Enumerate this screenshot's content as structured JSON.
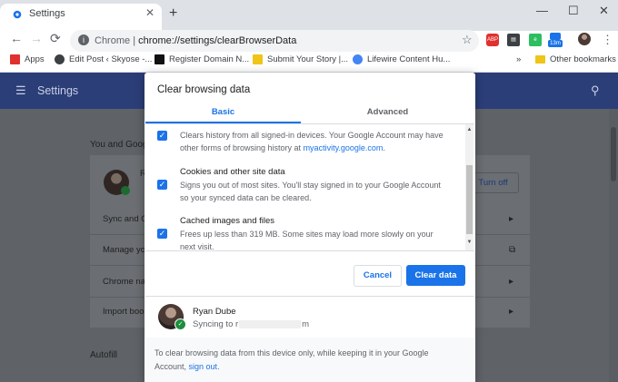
{
  "browser": {
    "tab": {
      "title": "Settings",
      "close": "✕"
    },
    "new_tab": "+",
    "window_controls": {
      "minimize": "—",
      "maximize": "☐",
      "close": "✕"
    },
    "nav": {
      "back": "←",
      "forward": "→",
      "reload": "⟳"
    },
    "omnibox": {
      "host_label": "Chrome",
      "separator": "|",
      "url": "chrome://settings/clearBrowserData",
      "star": "☆"
    },
    "extensions": [
      {
        "name": "abp-extension-icon",
        "color": "#e0302f",
        "text": "ABP"
      },
      {
        "name": "extension-icon-2",
        "color": "#3c4043",
        "text": "▤"
      },
      {
        "name": "evernote-icon",
        "color": "#2dbe60",
        "text": "e"
      },
      {
        "name": "extension-icon-4",
        "color": "#1e8e3e",
        "text": "●"
      },
      {
        "name": "extension-badge-icon",
        "color": "#1a73e8",
        "text": "13m"
      }
    ],
    "menu": "⋮",
    "bookmarks": [
      {
        "label": "Apps",
        "icon": "apps-grid-icon",
        "color": "#e0302f"
      },
      {
        "label": "Edit Post ‹ Skyose -...",
        "icon": "globe-icon",
        "color": "#3c4043"
      },
      {
        "label": "Register Domain N...",
        "icon": "domain-icon",
        "color": "#111111"
      },
      {
        "label": "Submit Your Story |...",
        "icon": "story-icon",
        "color": "#f0c419"
      },
      {
        "label": "Lifewire Content Hu...",
        "icon": "google-icon",
        "color": "#4285f4"
      }
    ],
    "bookmarks_more": "»",
    "other_bookmarks": "Other bookmarks"
  },
  "settings": {
    "title": "Settings",
    "section_you": "You and Goog",
    "turn_off": "Turn off",
    "rows": [
      "Sync and G",
      "Manage yo",
      "Chrome na",
      "Import boo"
    ],
    "section_autofill": "Autofill"
  },
  "dialog": {
    "title": "Clear browsing data",
    "tabs": {
      "basic": "Basic",
      "advanced": "Advanced"
    },
    "options": [
      {
        "title": "",
        "desc_line1": "Clears history from all signed-in devices. Your Google Account may have",
        "desc_line2_prefix": "other forms of browsing history at ",
        "desc_link": "myactivity.google.com",
        "desc_line2_suffix": ".",
        "checked": true
      },
      {
        "title": "Cookies and other site data",
        "desc_line1": "Signs you out of most sites. You'll stay signed in to your Google Account",
        "desc_line2": "so your synced data can be cleared.",
        "checked": true
      },
      {
        "title": "Cached images and files",
        "desc_line1": "Frees up less than 319 MB. Some sites may load more slowly on your",
        "desc_line2": "next visit.",
        "checked": true
      }
    ],
    "buttons": {
      "cancel": "Cancel",
      "clear": "Clear data"
    },
    "account": {
      "name": "Ryan Dube",
      "sync_prefix": "Syncing to r",
      "sync_suffix": "m"
    },
    "footer": {
      "text_line1": "To clear browsing data from this device only, while keeping it in your Google",
      "text_line2_prefix": "Account, ",
      "link": "sign out",
      "text_line2_suffix": "."
    }
  }
}
